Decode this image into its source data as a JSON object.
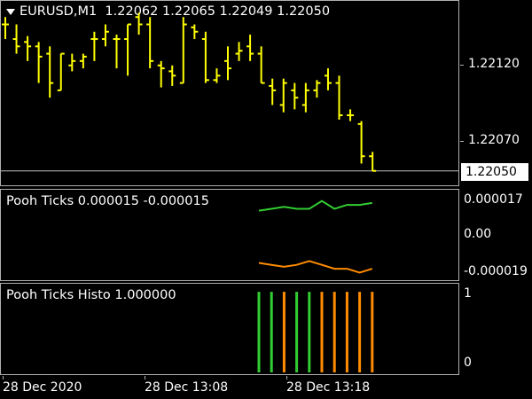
{
  "main_chart": {
    "symbol_label": "EURUSD,M1",
    "ohlc_label": "1.22062 1.22065 1.22049 1.22050",
    "price_labels": [
      "1.22120",
      "1.22070"
    ],
    "current_price": "1.22050",
    "bar_color": "#ffff00",
    "current_line_color": "#c0c0c0"
  },
  "ticks_indicator": {
    "label": "Pooh Ticks 0.000015 -0.000015",
    "scale_labels": [
      "0.000017",
      "0.00",
      "-0.000019"
    ],
    "up_color": "#32cd32",
    "down_color": "#ff8c00"
  },
  "histo_indicator": {
    "label": "Pooh Ticks Histo 1.000000",
    "scale_labels": [
      "1",
      "0"
    ]
  },
  "time_axis": {
    "labels": [
      "28 Dec 2020",
      "28 Dec 13:08",
      "28 Dec 13:18"
    ]
  },
  "chart_data": [
    {
      "type": "ohlc",
      "title": "EURUSD,M1",
      "ylim": [
        1.22045,
        1.2216
      ],
      "bars": [
        {
          "o": 1.2215,
          "h": 1.22155,
          "l": 1.2214,
          "c": 1.2215
        },
        {
          "o": 1.2214,
          "h": 1.2215,
          "l": 1.2213,
          "c": 1.22135
        },
        {
          "o": 1.22138,
          "h": 1.22142,
          "l": 1.22125,
          "c": 1.22135
        },
        {
          "o": 1.22135,
          "h": 1.22138,
          "l": 1.2211,
          "c": 1.22128
        },
        {
          "o": 1.2213,
          "h": 1.22135,
          "l": 1.221,
          "c": 1.2211
        },
        {
          "o": 1.22105,
          "h": 1.2213,
          "l": 1.22105,
          "c": 1.2213
        },
        {
          "o": 1.22122,
          "h": 1.2213,
          "l": 1.22118,
          "c": 1.22125
        },
        {
          "o": 1.22125,
          "h": 1.2213,
          "l": 1.2212,
          "c": 1.22128
        },
        {
          "o": 1.2214,
          "h": 1.22145,
          "l": 1.22125,
          "c": 1.2214
        },
        {
          "o": 1.2214,
          "h": 1.2215,
          "l": 1.22135,
          "c": 1.22145
        },
        {
          "o": 1.2214,
          "h": 1.22143,
          "l": 1.2212,
          "c": 1.2214
        },
        {
          "o": 1.2214,
          "h": 1.2215,
          "l": 1.22115,
          "c": 1.2215
        },
        {
          "o": 1.22155,
          "h": 1.22158,
          "l": 1.22143,
          "c": 1.2215
        },
        {
          "o": 1.2215,
          "h": 1.22155,
          "l": 1.2212,
          "c": 1.22125
        },
        {
          "o": 1.22122,
          "h": 1.22125,
          "l": 1.22107,
          "c": 1.2212
        },
        {
          "o": 1.22118,
          "h": 1.22122,
          "l": 1.22108,
          "c": 1.22115
        },
        {
          "o": 1.2211,
          "h": 1.22155,
          "l": 1.2211,
          "c": 1.2215
        },
        {
          "o": 1.22148,
          "h": 1.2215,
          "l": 1.2214,
          "c": 1.22145
        },
        {
          "o": 1.2214,
          "h": 1.22145,
          "l": 1.2211,
          "c": 1.22112
        },
        {
          "o": 1.22112,
          "h": 1.2212,
          "l": 1.2211,
          "c": 1.22115
        },
        {
          "o": 1.22125,
          "h": 1.22135,
          "l": 1.22112,
          "c": 1.2212
        },
        {
          "o": 1.2213,
          "h": 1.22138,
          "l": 1.22125,
          "c": 1.22132
        },
        {
          "o": 1.22135,
          "h": 1.22143,
          "l": 1.22125,
          "c": 1.2213
        },
        {
          "o": 1.2213,
          "h": 1.22135,
          "l": 1.2211,
          "c": 1.2211
        },
        {
          "o": 1.22108,
          "h": 1.22113,
          "l": 1.22095,
          "c": 1.22105
        },
        {
          "o": 1.22095,
          "h": 1.22113,
          "l": 1.2209,
          "c": 1.2211
        },
        {
          "o": 1.22105,
          "h": 1.2211,
          "l": 1.22092,
          "c": 1.221
        },
        {
          "o": 1.22095,
          "h": 1.2211,
          "l": 1.2209,
          "c": 1.22105
        },
        {
          "o": 1.22105,
          "h": 1.22112,
          "l": 1.221,
          "c": 1.2211
        },
        {
          "o": 1.22115,
          "h": 1.2212,
          "l": 1.22105,
          "c": 1.2211
        },
        {
          "o": 1.2211,
          "h": 1.22115,
          "l": 1.22085,
          "c": 1.22088
        },
        {
          "o": 1.22088,
          "h": 1.22092,
          "l": 1.22084,
          "c": 1.22088
        },
        {
          "o": 1.22082,
          "h": 1.22084,
          "l": 1.22055,
          "c": 1.2206
        },
        {
          "o": 1.2206,
          "h": 1.22063,
          "l": 1.2205,
          "c": 1.2205
        }
      ]
    },
    {
      "type": "line",
      "title": "Pooh Ticks",
      "ylim": [
        -2.2e-05,
        2.2e-05
      ],
      "x": [
        0,
        1,
        2,
        3,
        4,
        5,
        6,
        7,
        8,
        9
      ],
      "series": [
        {
          "values": [
            1.3e-05,
            1.4e-05,
            1.5e-05,
            1.4e-05,
            1.4e-05,
            1.8e-05,
            1.4e-05,
            1.6e-05,
            1.6e-05,
            1.7e-05
          ]
        },
        {
          "values": [
            -1.4e-05,
            -1.5e-05,
            -1.6e-05,
            -1.5e-05,
            -1.3e-05,
            -1.5e-05,
            -1.7e-05,
            -1.7e-05,
            -1.9e-05,
            -1.7e-05
          ]
        }
      ]
    },
    {
      "type": "bar",
      "title": "Pooh Ticks Histo",
      "ylim": [
        0,
        1.1
      ],
      "x": [
        0,
        1,
        2,
        3,
        4,
        5,
        6,
        7,
        8,
        9
      ],
      "values": [
        1,
        1,
        1,
        1,
        1,
        1,
        1,
        1,
        1,
        1
      ],
      "signs": [
        "up",
        "up",
        "down",
        "up",
        "up",
        "down",
        "down",
        "down",
        "down",
        "down"
      ]
    }
  ]
}
